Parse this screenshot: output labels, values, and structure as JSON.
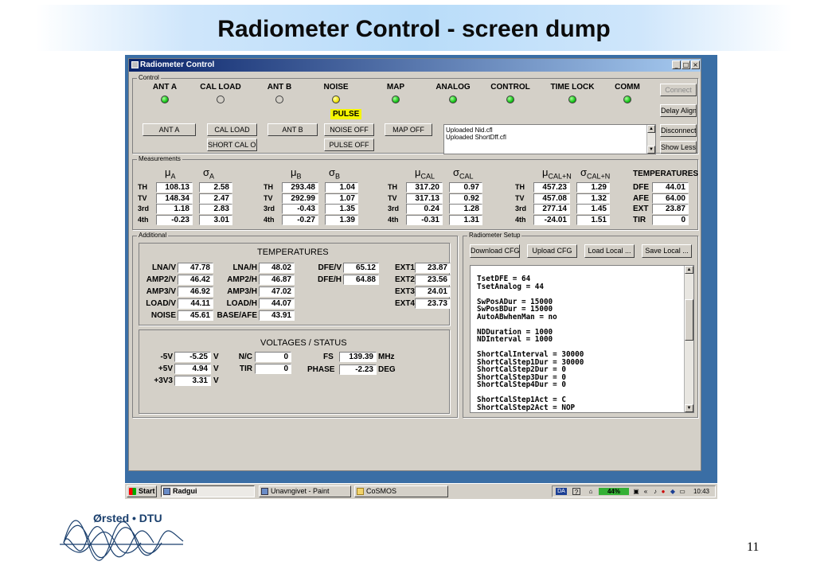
{
  "slide": {
    "title": "Radiometer Control - screen dump",
    "page_number": "11",
    "logo_text": "Ørsted • DTU"
  },
  "window": {
    "title": "Radiometer Control",
    "icons": {
      "minimize": "minimize-icon",
      "maximize": "maximize-icon",
      "close": "close-icon"
    }
  },
  "control": {
    "group_label": "Control",
    "indicators": [
      {
        "label": "ANT A",
        "state": "on"
      },
      {
        "label": "CAL LOAD",
        "state": "off"
      },
      {
        "label": "ANT B",
        "state": "off"
      },
      {
        "label": "NOISE",
        "state": "yellow"
      },
      {
        "label": "MAP",
        "state": "on"
      },
      {
        "label": "ANALOG",
        "state": "on"
      },
      {
        "label": "CONTROL",
        "state": "on"
      },
      {
        "label": "TIME LOCK",
        "state": "on"
      },
      {
        "label": "COMM",
        "state": "on"
      }
    ],
    "pulse_label": "PULSE",
    "colors": {
      "led_on": "#16c419",
      "led_yellow": "#f2e40a",
      "pulse_badge": "#f5f500"
    },
    "buttons": {
      "ant_a": "ANT A",
      "cal_load": "CAL LOAD",
      "short_cal_off": "SHORT CAL OFF",
      "ant_b": "ANT B",
      "noise_off": "NOISE OFF",
      "pulse_off": "PULSE OFF",
      "map_off": "MAP OFF"
    },
    "log_lines": [
      "Uploaded Nid.cfl",
      "Uploaded ShortDff.cfl"
    ],
    "side_buttons": {
      "connect": "Connect",
      "delay_align": "Delay Align",
      "disconnect": "Disconnect",
      "show_less": "Show Less"
    }
  },
  "measurements": {
    "group_label": "Measurements",
    "mu": "μ",
    "sigma": "σ",
    "row_labels": [
      "TH",
      "TV",
      "3rd",
      "4th"
    ],
    "blocks": [
      {
        "sub": "A",
        "mu": [
          "108.13",
          "148.34",
          "1.18",
          "-0.23"
        ],
        "sigma": [
          "2.58",
          "2.47",
          "2.83",
          "3.01"
        ]
      },
      {
        "sub": "B",
        "mu": [
          "293.48",
          "292.99",
          "-0.43",
          "-0.27"
        ],
        "sigma": [
          "1.04",
          "1.07",
          "1.35",
          "1.39"
        ]
      },
      {
        "sub": "CAL",
        "mu": [
          "317.20",
          "317.13",
          "0.24",
          "-0.31"
        ],
        "sigma": [
          "0.97",
          "0.92",
          "1.28",
          "1.31"
        ]
      },
      {
        "sub": "CAL+N",
        "mu": [
          "457.23",
          "457.08",
          "277.14",
          "-24.01"
        ],
        "sigma": [
          "1.29",
          "1.32",
          "1.45",
          "1.51"
        ]
      }
    ],
    "temps_title": "TEMPERATURES",
    "temps": [
      {
        "label": "DFE",
        "value": "44.01"
      },
      {
        "label": "AFE",
        "value": "64.00"
      },
      {
        "label": "EXT",
        "value": "23.87"
      },
      {
        "label": "TIR",
        "value": "0"
      }
    ]
  },
  "additional": {
    "group_label": "Additional",
    "temps_title": "TEMPERATURES",
    "col1": [
      {
        "label": "LNA/V",
        "value": "47.78"
      },
      {
        "label": "AMP2/V",
        "value": "46.42"
      },
      {
        "label": "AMP3/V",
        "value": "46.92"
      },
      {
        "label": "LOAD/V",
        "value": "44.11"
      },
      {
        "label": "NOISE",
        "value": "45.61"
      }
    ],
    "col2": [
      {
        "label": "LNA/H",
        "value": "48.02"
      },
      {
        "label": "AMP2/H",
        "value": "46.87"
      },
      {
        "label": "AMP3/H",
        "value": "47.02"
      },
      {
        "label": "LOAD/H",
        "value": "44.07"
      },
      {
        "label": "BASE/AFE",
        "value": "43.91"
      }
    ],
    "col3": [
      {
        "label": "DFE/V",
        "value": "65.12"
      },
      {
        "label": "DFE/H",
        "value": "64.88"
      }
    ],
    "col4": [
      {
        "label": "EXT1",
        "value": "23.87"
      },
      {
        "label": "EXT2",
        "value": "23.56"
      },
      {
        "label": "EXT3",
        "value": "24.01"
      },
      {
        "label": "EXT4",
        "value": "23.73"
      }
    ],
    "voltages_title": "VOLTAGES / STATUS",
    "volts": [
      {
        "label": "-5V",
        "value": "-5.25",
        "unit": "V"
      },
      {
        "label": "+5V",
        "value": "4.94",
        "unit": "V"
      },
      {
        "label": "+3V3",
        "value": "3.31",
        "unit": "V"
      }
    ],
    "status": [
      {
        "label": "N/C",
        "value": "0"
      },
      {
        "label": "TIR",
        "value": "0"
      }
    ],
    "fs": {
      "label": "FS",
      "value": "139.39",
      "unit": "MHz"
    },
    "phase": {
      "label": "PHASE",
      "value": "-2.23",
      "unit": "DEG"
    }
  },
  "setup": {
    "group_label": "Radiometer Setup",
    "buttons": {
      "download": "Download CFG",
      "upload": "Upload CFG",
      "load_local": "Load Local ...",
      "save_local": "Save Local ..."
    },
    "lines": [
      "TsetDFE = 64",
      "TsetAnalog = 44",
      "",
      "SwPosADur = 15000",
      "SwPosBDur = 15000",
      "AutoABwhenMan = no",
      "",
      "NDDuration = 1000",
      "NDInterval = 1000",
      "",
      "ShortCalInterval = 30000",
      "ShortCalStep1Dur = 30000",
      "ShortCalStep2Dur = 0",
      "ShortCalStep3Dur = 0",
      "ShortCalStep4Dur = 0",
      "",
      "ShortCalStep1Act = C",
      "ShortCalStep2Act = NOP"
    ]
  },
  "taskbar": {
    "start": "Start",
    "tasks": [
      {
        "label": "Radgui",
        "active": true
      },
      {
        "label": "Unavngivet - Paint",
        "active": false
      },
      {
        "label": "CoSMOS",
        "active": false
      }
    ],
    "battery": "44%",
    "lang": "DA",
    "clock": "10:43"
  }
}
